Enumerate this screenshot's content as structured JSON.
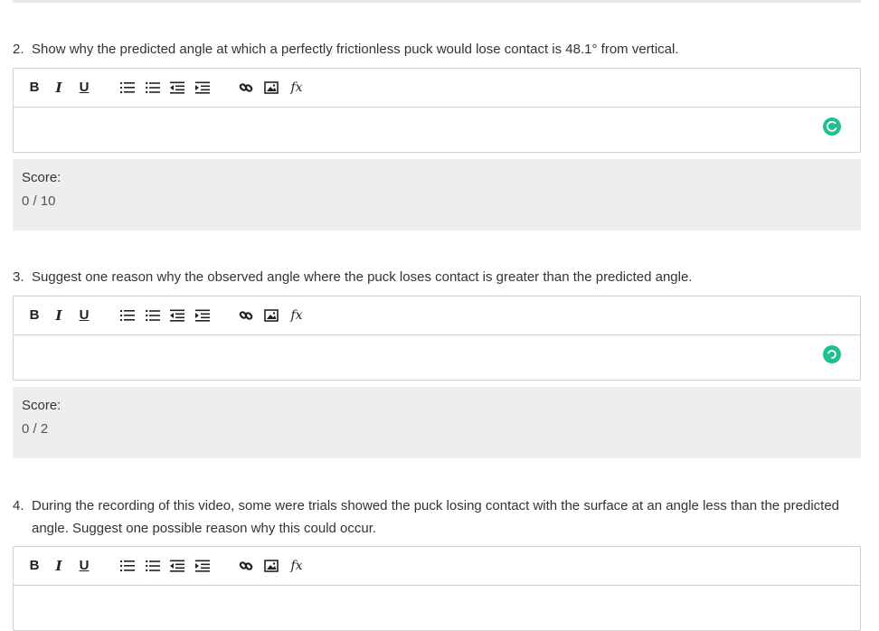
{
  "questions": [
    {
      "number": "2.",
      "text": "Show why the predicted angle at which a perfectly frictionless puck would lose contact is 48.1° from vertical.",
      "score_label": "Score:",
      "score_value": "0 / 10"
    },
    {
      "number": "3.",
      "text": "Suggest one reason why the observed angle where the puck loses contact is greater than the predicted angle.",
      "score_label": "Score:",
      "score_value": "0 / 2"
    },
    {
      "number": "4.",
      "text": "During the recording of this video, some were trials showed the puck losing contact with the surface at an angle less than the predicted angle. Suggest one possible reason why this could occur."
    }
  ],
  "toolbar": {
    "bold": "B",
    "italic": "I",
    "underline": "U",
    "formula": "fx"
  },
  "colors": {
    "status_accent": "#1fbf92",
    "score_bg": "#eeeeee",
    "border": "#cfcfcf"
  },
  "icons": [
    "bold-icon",
    "italic-icon",
    "underline-icon",
    "ordered-list-icon",
    "unordered-list-icon",
    "outdent-icon",
    "indent-icon",
    "link-icon",
    "image-icon",
    "formula-icon",
    "status-icon"
  ]
}
